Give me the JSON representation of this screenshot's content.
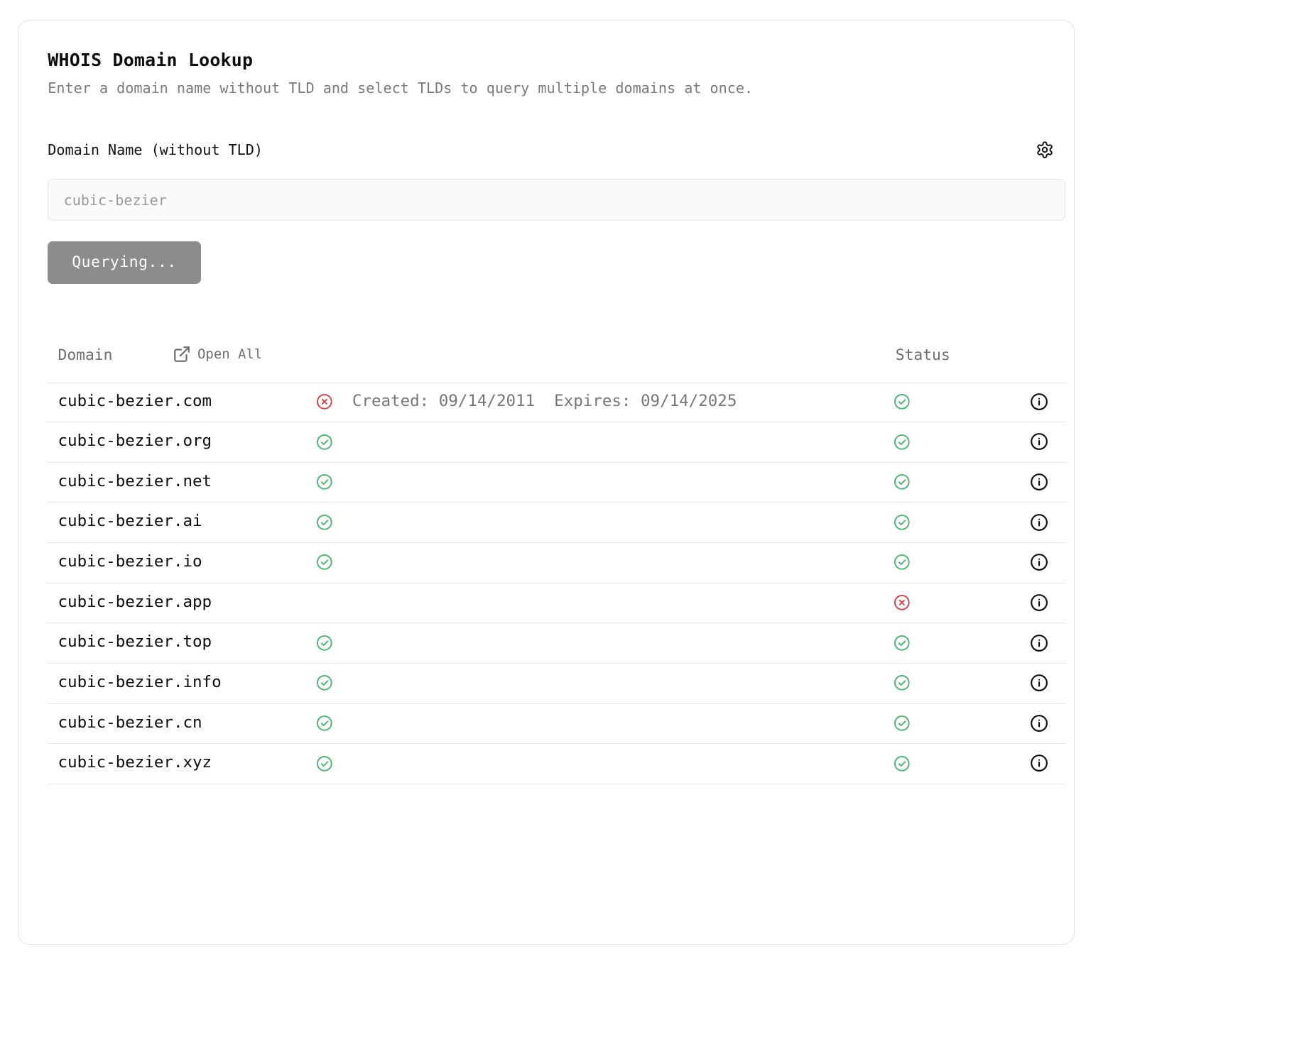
{
  "header": {
    "title": "WHOIS Domain Lookup",
    "subtitle": "Enter a domain name without TLD and select TLDs to query multiple domains at once."
  },
  "form": {
    "label": "Domain Name (without TLD)",
    "placeholder": "cubic-bezier",
    "value": "",
    "button_label": "Querying...",
    "settings_icon": "gear-icon"
  },
  "table": {
    "col_domain": "Domain",
    "open_all_label": "Open All",
    "col_status": "Status",
    "rows": [
      {
        "domain": "cubic-bezier.com",
        "available": "taken",
        "dates": "Created: 09/14/2011  Expires: 09/14/2025",
        "status": "ok"
      },
      {
        "domain": "cubic-bezier.org",
        "available": "ok",
        "dates": "",
        "status": "ok"
      },
      {
        "domain": "cubic-bezier.net",
        "available": "ok",
        "dates": "",
        "status": "ok"
      },
      {
        "domain": "cubic-bezier.ai",
        "available": "ok",
        "dates": "",
        "status": "ok"
      },
      {
        "domain": "cubic-bezier.io",
        "available": "ok",
        "dates": "",
        "status": "ok"
      },
      {
        "domain": "cubic-bezier.app",
        "available": "none",
        "dates": "",
        "status": "error"
      },
      {
        "domain": "cubic-bezier.top",
        "available": "ok",
        "dates": "",
        "status": "ok"
      },
      {
        "domain": "cubic-bezier.info",
        "available": "ok",
        "dates": "",
        "status": "ok"
      },
      {
        "domain": "cubic-bezier.cn",
        "available": "ok",
        "dates": "",
        "status": "ok"
      },
      {
        "domain": "cubic-bezier.xyz",
        "available": "ok",
        "dates": "",
        "status": "ok"
      }
    ]
  },
  "colors": {
    "ok": "#4cb870",
    "error": "#d9434b",
    "button_bg": "#8c8c8c",
    "muted_text": "#7a7a7a"
  }
}
